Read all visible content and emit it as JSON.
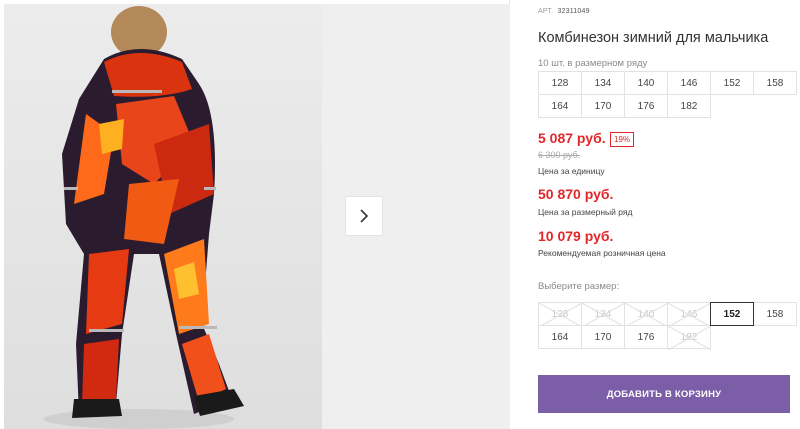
{
  "product": {
    "art_label": "АРТ.",
    "art_number": "32311049",
    "title": "Комбинезон зимний для мальчика",
    "size_count": "10 шт. в размерном ряду",
    "size_range": [
      "128",
      "134",
      "140",
      "146",
      "152",
      "158",
      "164",
      "170",
      "176",
      "182"
    ]
  },
  "prices": {
    "unit_price": "5 087 руб.",
    "discount": "19%",
    "old_price": "6 300 руб.",
    "unit_label": "Цена за единицу",
    "range_price": "50 870 руб.",
    "range_label": "Цена за размерный ряд",
    "retail_price": "10 079 руб.",
    "retail_label": "Рекомендуемая розничная цена"
  },
  "size_picker": {
    "label": "Выберите размер:",
    "options": [
      {
        "label": "128",
        "available": false
      },
      {
        "label": "134",
        "available": false
      },
      {
        "label": "140",
        "available": false
      },
      {
        "label": "146",
        "available": false
      },
      {
        "label": "152",
        "available": true,
        "selected": true
      },
      {
        "label": "158",
        "available": true
      },
      {
        "label": "164",
        "available": true
      },
      {
        "label": "170",
        "available": true
      },
      {
        "label": "176",
        "available": true
      },
      {
        "label": "182",
        "available": false
      }
    ]
  },
  "actions": {
    "add_to_cart": "ДОБАВИТЬ В КОРЗИНУ"
  },
  "gallery": {
    "next_icon": "chevron-right-icon"
  },
  "colors": {
    "accent_red": "#e3262a",
    "cart_button": "#7b5ea7"
  }
}
